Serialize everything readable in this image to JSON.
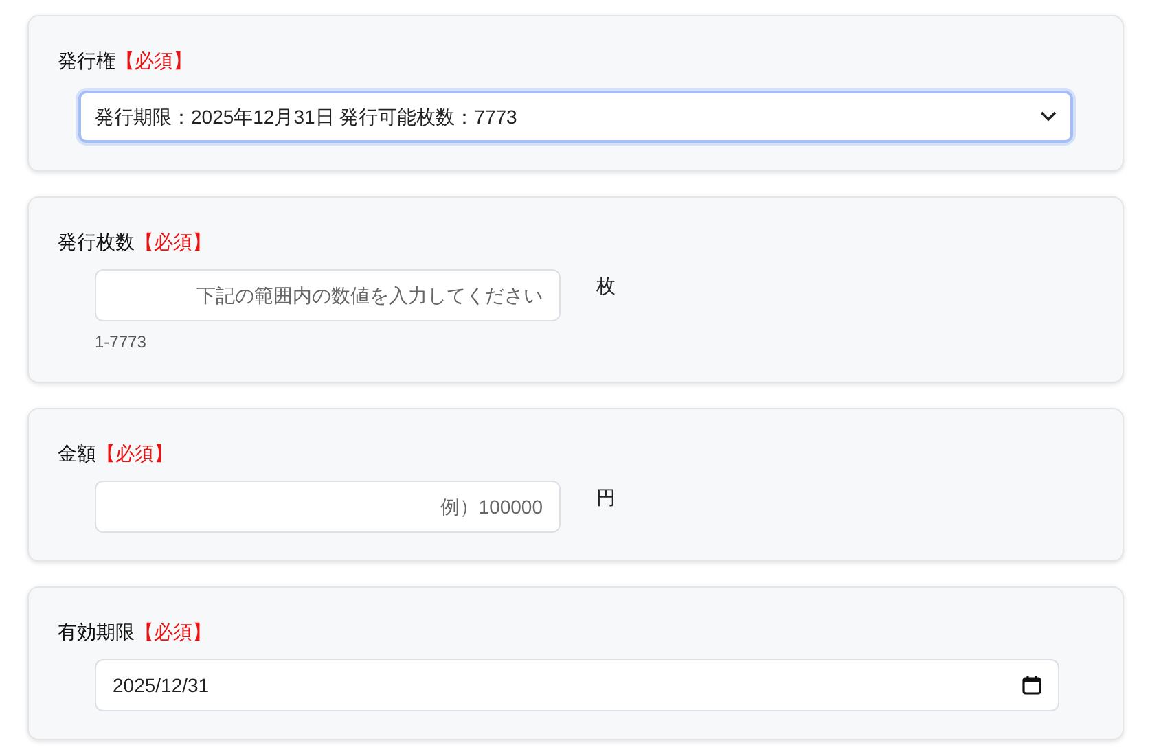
{
  "fields": [
    {
      "kind": "select",
      "label": "発行権",
      "required": "【必須】",
      "value": "発行期限：2025年12月31日 発行可能枚数：7773",
      "focused": true
    },
    {
      "kind": "number",
      "label": "発行枚数",
      "required": "【必須】",
      "placeholder": "下記の範囲内の数値を入力してください",
      "unit": "枚",
      "hint": "1-7773"
    },
    {
      "kind": "number",
      "label": "金額",
      "required": "【必須】",
      "placeholder": "例）100000",
      "unit": "円"
    },
    {
      "kind": "date",
      "label": "有効期限",
      "required": "【必須】",
      "value": "2025/12/31"
    }
  ]
}
